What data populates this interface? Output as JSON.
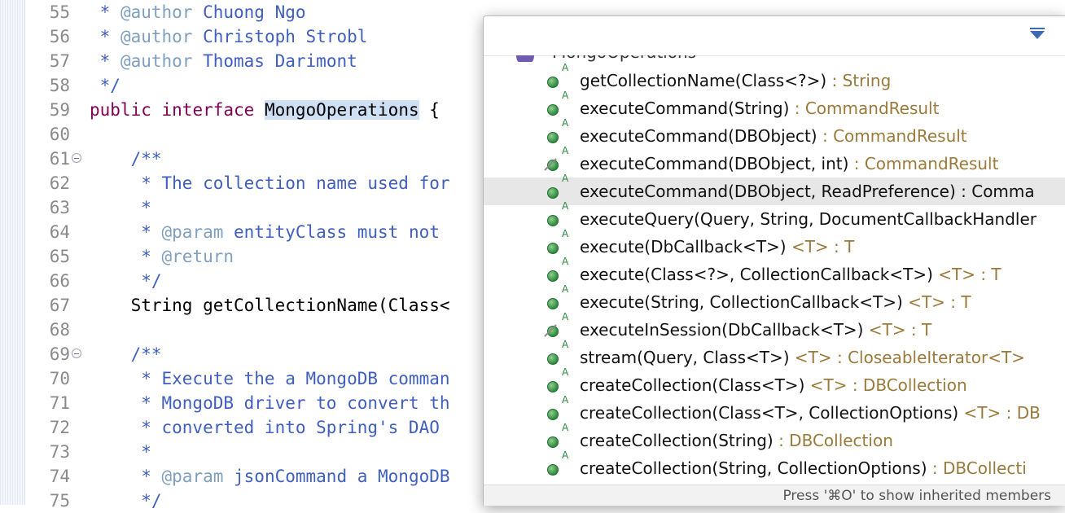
{
  "editor": {
    "lines": [
      {
        "num": "55",
        "fold": false,
        "parts": [
          {
            "t": " * ",
            "c": "jd"
          },
          {
            "t": "@author",
            "c": "jdtag"
          },
          {
            "t": " Chuong Ngo",
            "c": "jdtext"
          }
        ]
      },
      {
        "num": "56",
        "fold": false,
        "parts": [
          {
            "t": " * ",
            "c": "jd"
          },
          {
            "t": "@author",
            "c": "jdtag"
          },
          {
            "t": " Christoph Strobl",
            "c": "jdtext"
          }
        ]
      },
      {
        "num": "57",
        "fold": false,
        "parts": [
          {
            "t": " * ",
            "c": "jd"
          },
          {
            "t": "@author",
            "c": "jdtag"
          },
          {
            "t": " Thomas Darimont",
            "c": "jdtext"
          }
        ]
      },
      {
        "num": "58",
        "fold": false,
        "parts": [
          {
            "t": " */",
            "c": "jd"
          }
        ]
      },
      {
        "num": "59",
        "fold": false,
        "parts": [
          {
            "t": "public",
            "c": "kw"
          },
          {
            "t": " ",
            "c": ""
          },
          {
            "t": "interface",
            "c": "kw"
          },
          {
            "t": " ",
            "c": ""
          },
          {
            "t": "MongoOperations",
            "c": "sel"
          },
          {
            "t": " {",
            "c": ""
          }
        ]
      },
      {
        "num": "60",
        "fold": false,
        "parts": []
      },
      {
        "num": "61",
        "fold": true,
        "parts": [
          {
            "t": "    /**",
            "c": "jd"
          }
        ]
      },
      {
        "num": "62",
        "fold": false,
        "parts": [
          {
            "t": "     * The collection name used for",
            "c": "jd"
          }
        ]
      },
      {
        "num": "63",
        "fold": false,
        "parts": [
          {
            "t": "     *",
            "c": "jd"
          }
        ]
      },
      {
        "num": "64",
        "fold": false,
        "parts": [
          {
            "t": "     * ",
            "c": "jd"
          },
          {
            "t": "@param",
            "c": "jdtag"
          },
          {
            "t": " entityClass must not",
            "c": "jdtext"
          }
        ]
      },
      {
        "num": "65",
        "fold": false,
        "parts": [
          {
            "t": "     * ",
            "c": "jd"
          },
          {
            "t": "@return",
            "c": "jdtag"
          }
        ]
      },
      {
        "num": "66",
        "fold": false,
        "parts": [
          {
            "t": "     */",
            "c": "jd"
          }
        ]
      },
      {
        "num": "67",
        "fold": false,
        "parts": [
          {
            "t": "    String getCollectionName(Class<",
            "c": ""
          }
        ]
      },
      {
        "num": "68",
        "fold": false,
        "parts": []
      },
      {
        "num": "69",
        "fold": true,
        "parts": [
          {
            "t": "    /**",
            "c": "jd"
          }
        ]
      },
      {
        "num": "70",
        "fold": false,
        "parts": [
          {
            "t": "     * Execute the a MongoDB comman",
            "c": "jd"
          }
        ]
      },
      {
        "num": "71",
        "fold": false,
        "parts": [
          {
            "t": "     * MongoDB driver to convert th",
            "c": "jd"
          }
        ]
      },
      {
        "num": "72",
        "fold": false,
        "parts": [
          {
            "t": "     * converted into Spring's DAO",
            "c": "jd"
          }
        ]
      },
      {
        "num": "73",
        "fold": false,
        "parts": [
          {
            "t": "     *",
            "c": "jd"
          }
        ]
      },
      {
        "num": "74",
        "fold": false,
        "parts": [
          {
            "t": "     * ",
            "c": "jd"
          },
          {
            "t": "@param",
            "c": "jdtag"
          },
          {
            "t": " jsonCommand a MongoDB",
            "c": "jdtext"
          }
        ]
      },
      {
        "num": "75",
        "fold": false,
        "parts": [
          {
            "t": "     */",
            "c": "jd"
          }
        ]
      }
    ]
  },
  "popup": {
    "partial_label": "MongoOperations",
    "menu_icon": "view-menu-icon",
    "items": [
      {
        "sig": "getCollectionName(Class<?>)",
        "ret": " : String",
        "deprecated": false,
        "highlighted": false
      },
      {
        "sig": "executeCommand(String)",
        "ret": " : CommandResult",
        "deprecated": false,
        "highlighted": false
      },
      {
        "sig": "executeCommand(DBObject)",
        "ret": " : CommandResult",
        "deprecated": false,
        "highlighted": false
      },
      {
        "sig": "executeCommand(DBObject, int)",
        "ret": " : CommandResult",
        "deprecated": true,
        "highlighted": false
      },
      {
        "sig": "executeCommand(DBObject, ReadPreference) : Comma",
        "ret": "",
        "deprecated": false,
        "highlighted": true
      },
      {
        "sig": "executeQuery(Query, String, DocumentCallbackHandler",
        "ret": "",
        "deprecated": false,
        "highlighted": false
      },
      {
        "sig": "execute(DbCallback<T>)",
        "ret": " <T> : T",
        "deprecated": false,
        "highlighted": false
      },
      {
        "sig": "execute(Class<?>, CollectionCallback<T>)",
        "ret": " <T> : T",
        "deprecated": false,
        "highlighted": false
      },
      {
        "sig": "execute(String, CollectionCallback<T>)",
        "ret": " <T> : T",
        "deprecated": false,
        "highlighted": false
      },
      {
        "sig": "executeInSession(DbCallback<T>)",
        "ret": " <T> : T",
        "deprecated": true,
        "highlighted": false
      },
      {
        "sig": "stream(Query, Class<T>)",
        "ret": " <T> : CloseableIterator<T>",
        "deprecated": false,
        "highlighted": false
      },
      {
        "sig": "createCollection(Class<T>)",
        "ret": " <T> : DBCollection",
        "deprecated": false,
        "highlighted": false
      },
      {
        "sig": "createCollection(Class<T>, CollectionOptions)",
        "ret": " <T> : DB",
        "deprecated": false,
        "highlighted": false
      },
      {
        "sig": "createCollection(String)",
        "ret": " : DBCollection",
        "deprecated": false,
        "highlighted": false
      },
      {
        "sig": "createCollection(String, CollectionOptions)",
        "ret": " : DBCollecti",
        "deprecated": false,
        "highlighted": false
      }
    ],
    "footer": "Press '⌘O' to show inherited members"
  }
}
